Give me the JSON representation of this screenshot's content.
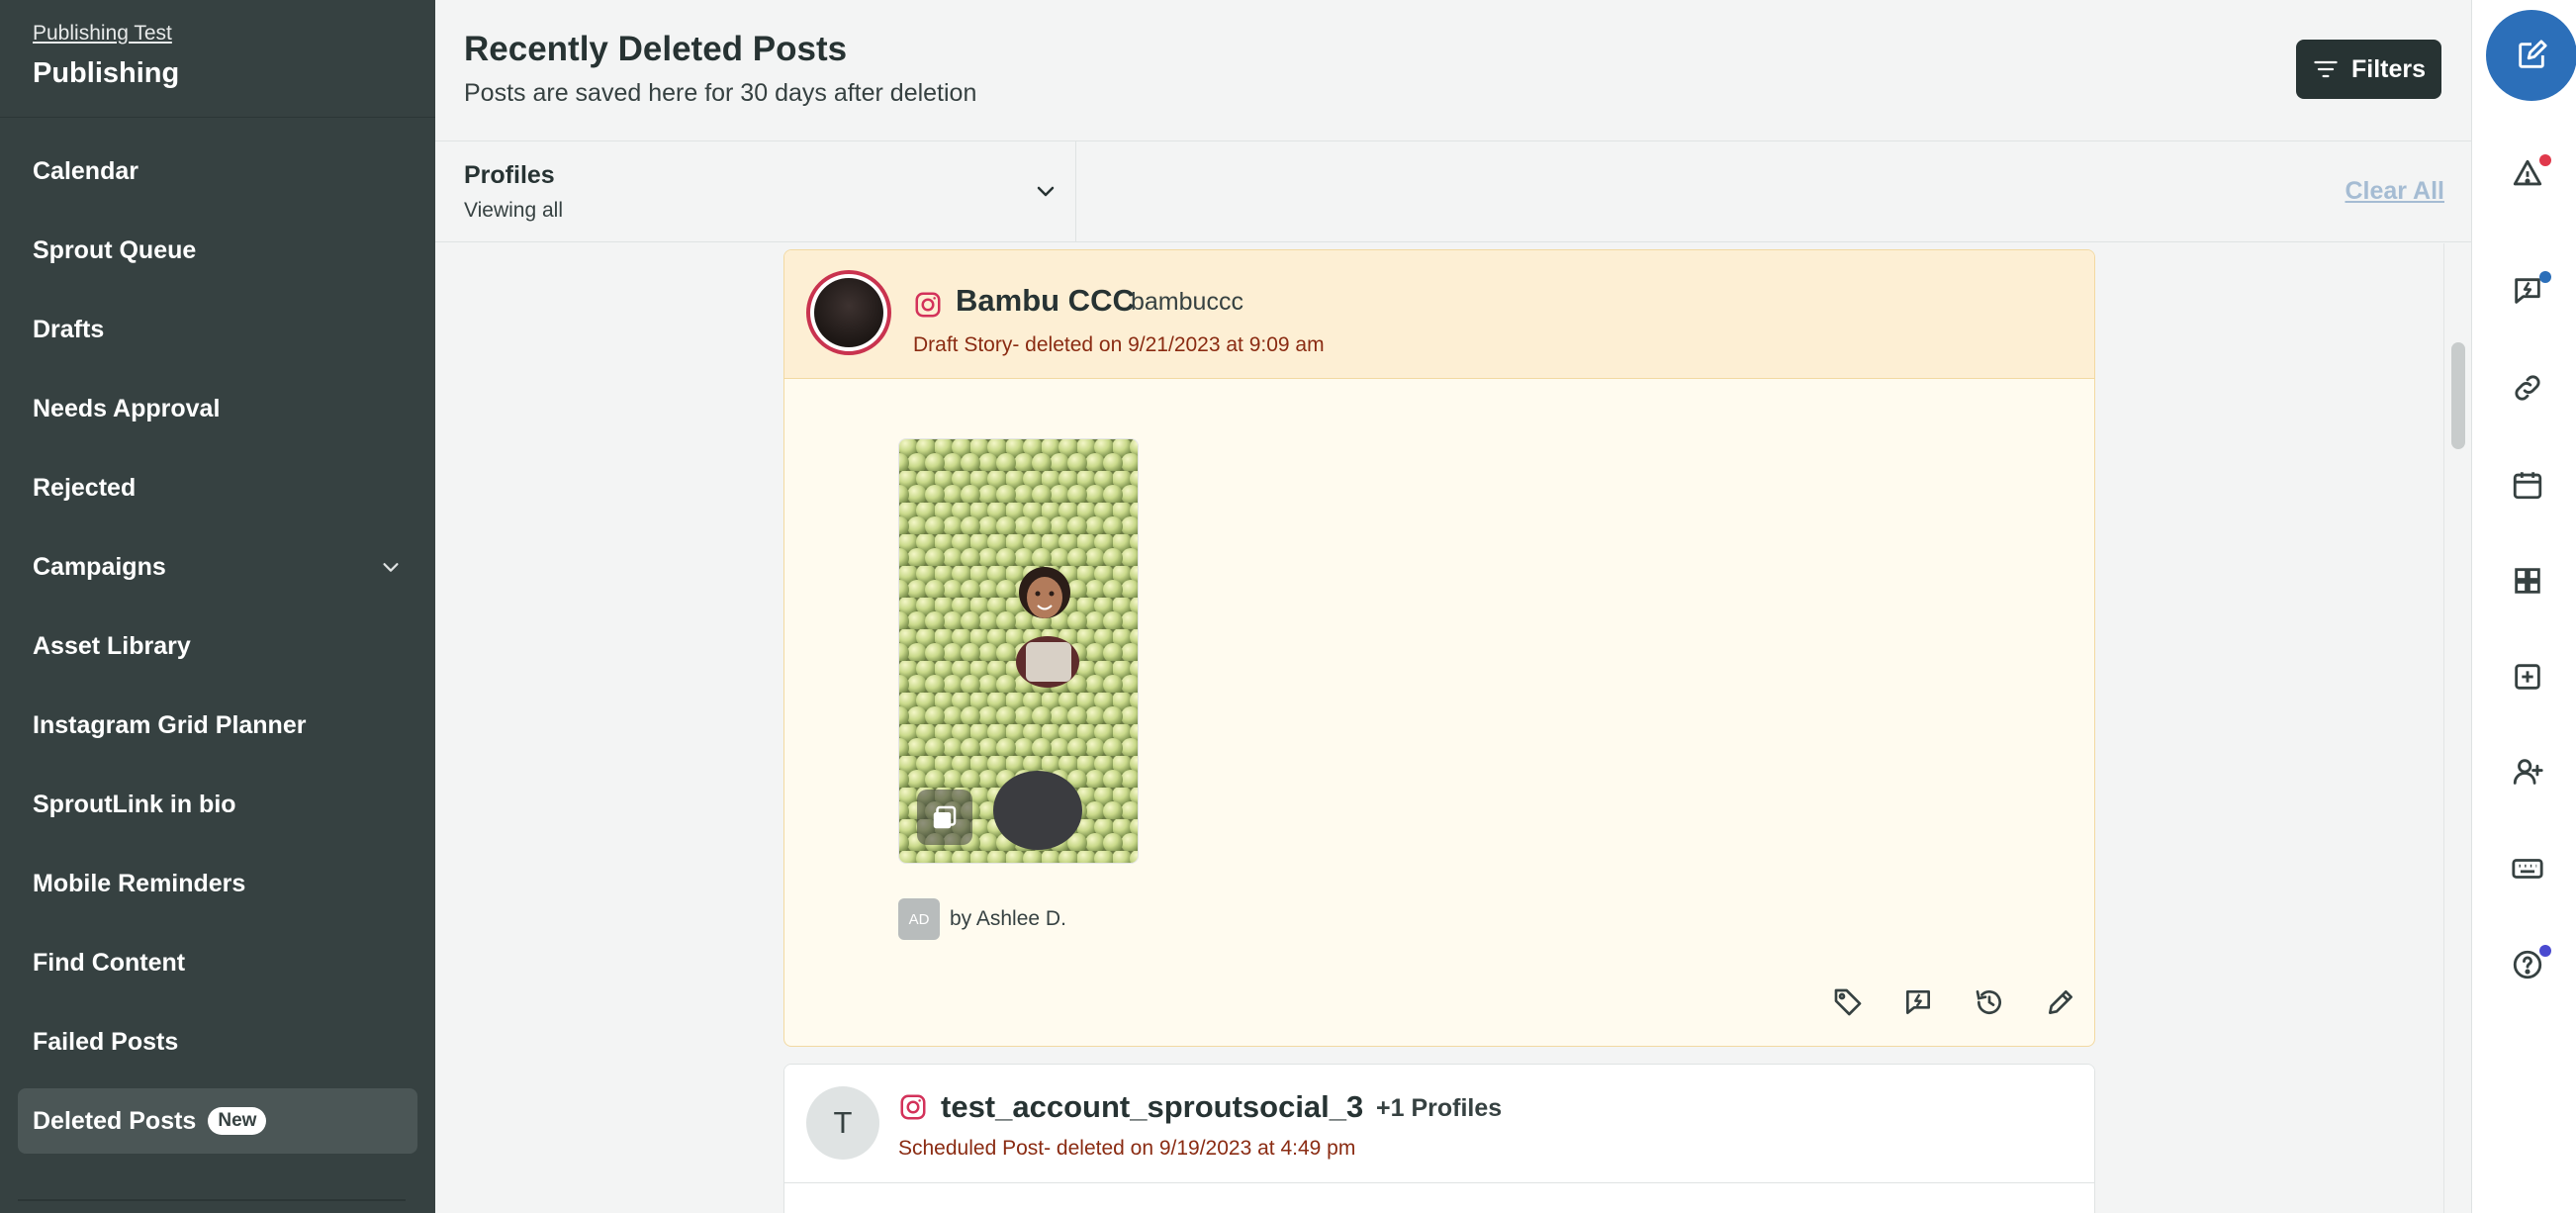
{
  "sidebar": {
    "org": "Publishing Test",
    "title": "Publishing",
    "items": [
      {
        "label": "Calendar"
      },
      {
        "label": "Sprout Queue"
      },
      {
        "label": "Drafts"
      },
      {
        "label": "Needs Approval"
      },
      {
        "label": "Rejected"
      },
      {
        "label": "Campaigns"
      },
      {
        "label": "Asset Library"
      },
      {
        "label": "Instagram Grid Planner"
      },
      {
        "label": "SproutLink in bio"
      },
      {
        "label": "Mobile Reminders"
      },
      {
        "label": "Find Content"
      },
      {
        "label": "Failed Posts"
      },
      {
        "label": "Deleted Posts",
        "badge": "New"
      }
    ]
  },
  "header": {
    "title": "Recently Deleted Posts",
    "subtitle": "Posts are saved here for 30 days after deletion",
    "filters_label": "Filters"
  },
  "profiles": {
    "label": "Profiles",
    "value": "Viewing all",
    "clear_all": "Clear All"
  },
  "posts": [
    {
      "account_name": "Bambu CCC",
      "handle": "bambuccc",
      "meta": "Draft Story- deleted on 9/21/2023 at 9:09 am",
      "author_initials": "AD",
      "author": "by Ashlee D."
    },
    {
      "avatar_letter": "T",
      "account_name": "test_account_sproutsocial_3",
      "extra": "+1 Profiles",
      "meta": "Scheduled Post- deleted on 9/19/2023 at 4:49 pm"
    }
  ],
  "icons": {
    "network": "instagram-icon",
    "actions": [
      "tag-icon",
      "message-icon",
      "history-icon",
      "pencil-icon"
    ],
    "rail": [
      "compose-icon",
      "alert-icon",
      "message-icon",
      "link-icon",
      "calendar-icon",
      "grid-icon",
      "add-icon",
      "add-user-icon",
      "keyboard-icon",
      "help-icon"
    ]
  },
  "colors": {
    "sidebar_bg": "#364141",
    "draft_header": "#fdefd4",
    "meta_text": "#8a2b12",
    "compose": "#2c6fb9",
    "alert_dot": "#e0384b",
    "message_dot": "#2c6fb9",
    "help_dot": "#4a4ad0"
  }
}
